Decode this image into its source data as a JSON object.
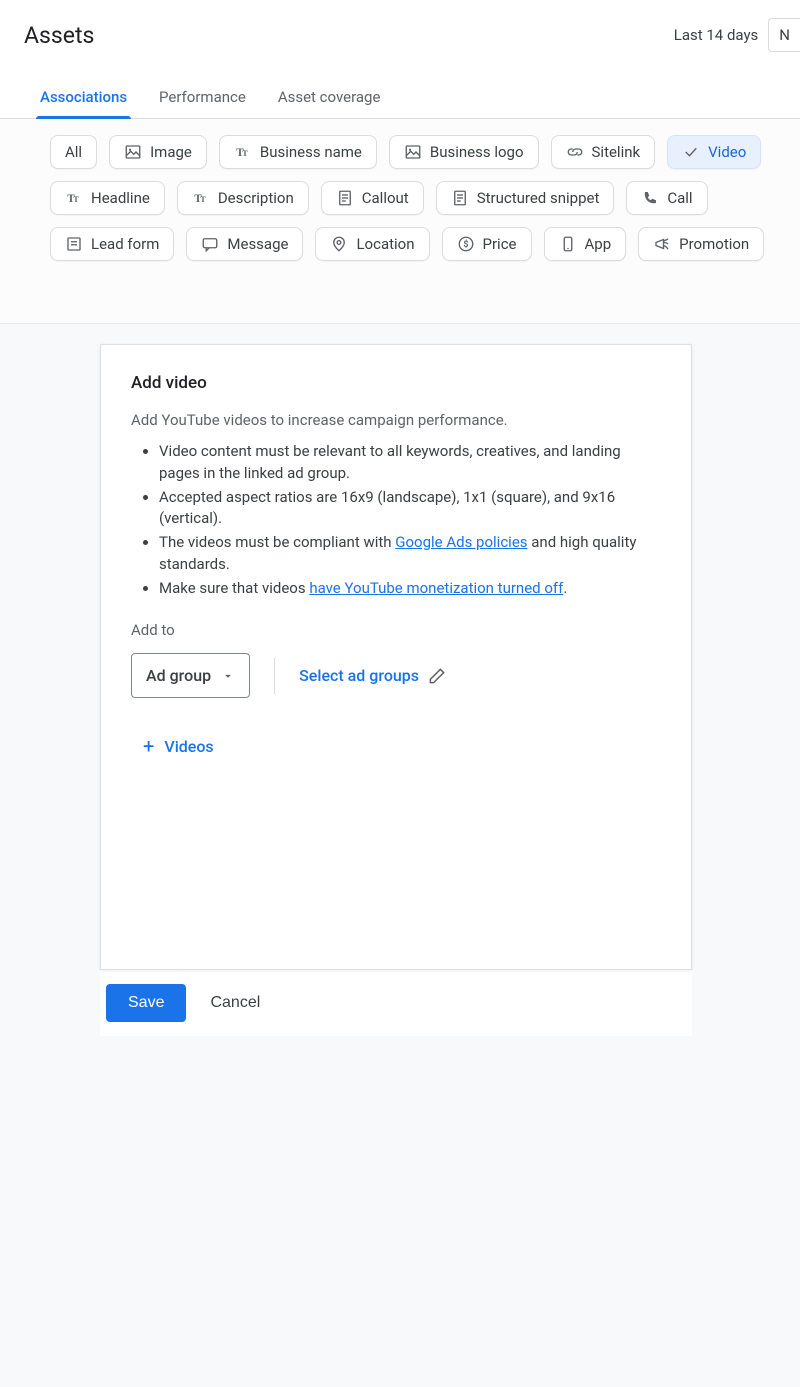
{
  "header": {
    "title": "Assets",
    "date_range": "Last 14 days",
    "date_char": "N"
  },
  "tabs": [
    {
      "label": "Associations",
      "active": true
    },
    {
      "label": "Performance",
      "active": false
    },
    {
      "label": "Asset coverage",
      "active": false
    }
  ],
  "chips": {
    "row1": [
      {
        "icon": "none",
        "label": "All",
        "selected": false
      },
      {
        "icon": "image",
        "label": "Image",
        "selected": false
      },
      {
        "icon": "tt",
        "label": "Business name",
        "selected": false
      },
      {
        "icon": "image",
        "label": "Business logo",
        "selected": false
      },
      {
        "icon": "link",
        "label": "Sitelink",
        "selected": false
      },
      {
        "icon": "check",
        "label": "Video",
        "selected": true
      }
    ],
    "row2": [
      {
        "icon": "tt",
        "label": "Headline",
        "selected": false
      },
      {
        "icon": "tt",
        "label": "Description",
        "selected": false
      },
      {
        "icon": "doc",
        "label": "Callout",
        "selected": false
      },
      {
        "icon": "doc",
        "label": "Structured snippet",
        "selected": false
      },
      {
        "icon": "phone",
        "label": "Call",
        "selected": false
      }
    ],
    "row3": [
      {
        "icon": "form",
        "label": "Lead form",
        "selected": false
      },
      {
        "icon": "msg",
        "label": "Message",
        "selected": false
      },
      {
        "icon": "pin",
        "label": "Location",
        "selected": false
      },
      {
        "icon": "price",
        "label": "Price",
        "selected": false
      },
      {
        "icon": "app",
        "label": "App",
        "selected": false
      },
      {
        "icon": "promo",
        "label": "Promotion",
        "selected": false
      }
    ]
  },
  "card": {
    "title": "Add video",
    "desc": "Add YouTube videos to increase campaign performance.",
    "bullets": {
      "b1a": "Video content must be relevant to all keywords, creatives, and landing pages in the linked ad group.",
      "b2a": "Accepted aspect ratios are 16x9 (landscape), 1x1 (square), and 9x16 (vertical).",
      "b3a": "The videos must be compliant with ",
      "b3link": "Google Ads policies",
      "b3b": " and high quality standards.",
      "b4a": "Make sure that videos ",
      "b4link": "have YouTube monetization turned off",
      "b4b": "."
    },
    "addto_label": "Add to",
    "dropdown_value": "Ad group",
    "select_groups": "Select ad groups",
    "add_videos": "Videos"
  },
  "actions": {
    "save": "Save",
    "cancel": "Cancel"
  }
}
